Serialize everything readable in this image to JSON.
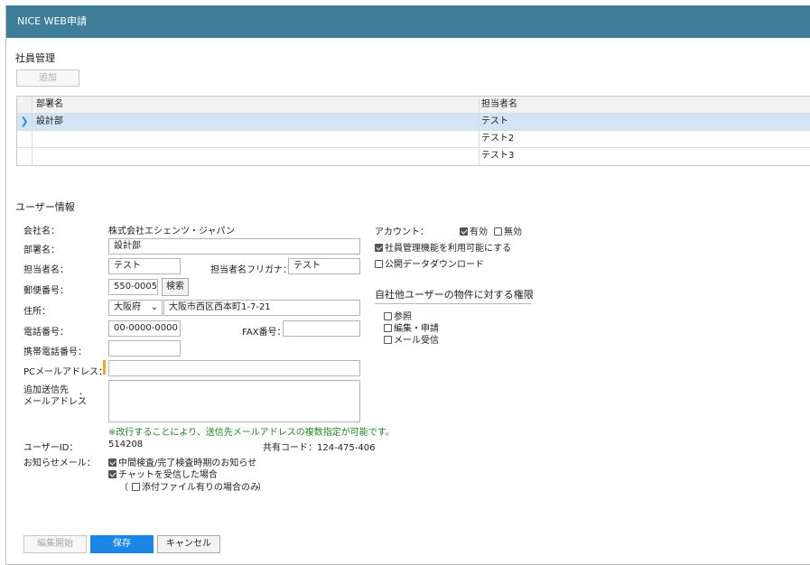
{
  "app": {
    "title": "NICE WEB申請"
  },
  "employee_mgmt": {
    "section_title": "社員管理",
    "add_button": "追加",
    "columns": [
      "部署名",
      "担当者名"
    ],
    "rows": [
      {
        "dept": "設計部",
        "person": "テスト"
      },
      {
        "dept": "",
        "person": "テスト2"
      },
      {
        "dept": "",
        "person": "テスト3"
      }
    ]
  },
  "user_info": {
    "section_title": "ユーザー情報",
    "company_label": "会社名：",
    "company_value": "株式会社エシェンツ・ジャパン",
    "dept_label": "部署名：",
    "dept_value": "設計部",
    "person_label": "担当者名：",
    "person_value": "テスト",
    "kana_label": "担当者名フリガナ：",
    "kana_value": "テスト",
    "postal_label": "郵便番号：",
    "postal_value": "550-0005",
    "search_button": "検索",
    "address_label": "住所：",
    "prefecture_value": "大阪府",
    "address_value": "大阪市西区西本町1-7-21",
    "phone_label": "電話番号：",
    "phone_value": "00-0000-0000",
    "fax_label": "FAX番号：",
    "fax_value": "",
    "mobile_label": "携帯電話番号：",
    "mobile_value": "",
    "pc_mail_label": "PCメールアドレス：",
    "pc_mail_value": "",
    "extra_mail_label_1": "追加送信先",
    "extra_mail_label_2": "メールアドレス",
    "extra_mail_colon": "：",
    "extra_mail_note": "※改行することにより、送信先メールアドレスの複数指定が可能です。",
    "user_id_label": "ユーザーID：",
    "user_id_value": "514208",
    "shared_code_label": "共有コード：124-475-406",
    "notify_label": "お知らせメール：",
    "notify_opt1": "中間検査/完了検査時期のお知らせ",
    "notify_opt2": "チャットを受信した場合",
    "notify_paren_open": "（",
    "notify_opt3": "添付ファイル有りの場合のみ",
    "notify_paren_close": "）"
  },
  "account": {
    "label": "アカウント：",
    "valid": "有効",
    "invalid": "無効",
    "opt_employee_mgmt": "社員管理機能を利用可能にする",
    "opt_public_download": "公開データダウンロード"
  },
  "permissions": {
    "title": "自社他ユーザーの物件に対する権限",
    "view": "参照",
    "edit": "編集・申請",
    "mail": "メール受信"
  },
  "footer": {
    "edit_start": "編集開始",
    "save": "保存",
    "cancel": "キャンセル"
  }
}
